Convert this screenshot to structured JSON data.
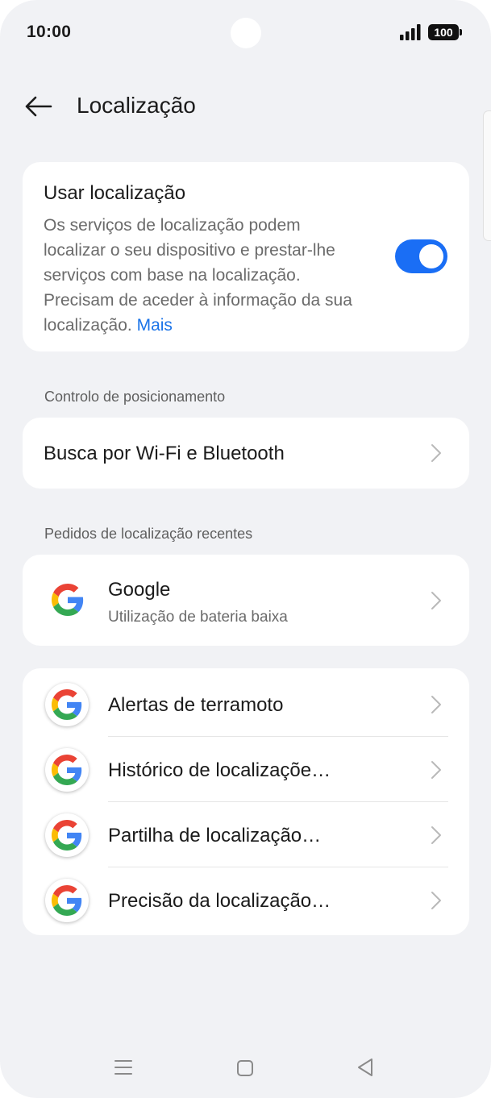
{
  "status_bar": {
    "time": "10:00",
    "battery": "100",
    "icons": [
      "signal-icon",
      "battery-icon"
    ]
  },
  "header": {
    "back_icon": "arrow-left-icon",
    "title": "Localização"
  },
  "location_card": {
    "title": "Usar localização",
    "description": "Os serviços de localização podem localizar o seu dispositivo e prestar-lhe serviços com base na localização. Precisam de aceder à informação da sua localização.",
    "more_link": "Mais",
    "toggle_on": true
  },
  "sections": {
    "positioning_label": "Controlo de posicionamento",
    "recent_label": "Pedidos de localização recentes"
  },
  "scan_row": {
    "title": "Busca por Wi-Fi e Bluetooth"
  },
  "recent_requests": [
    {
      "app": "Google",
      "subtitle": "Utilização de bateria baixa"
    }
  ],
  "services": [
    {
      "label": "Alertas de terramoto"
    },
    {
      "label": "Histórico de localizaçõe…"
    },
    {
      "label": "Partilha de localização…"
    },
    {
      "label": "Precisão da localização…"
    }
  ],
  "colors": {
    "accent": "#1a73e8",
    "toggle": "#1a6ef5",
    "background": "#f1f2f5",
    "card": "#ffffff"
  },
  "nav_bar": [
    "menu-icon",
    "home-icon",
    "back-triangle-icon"
  ]
}
